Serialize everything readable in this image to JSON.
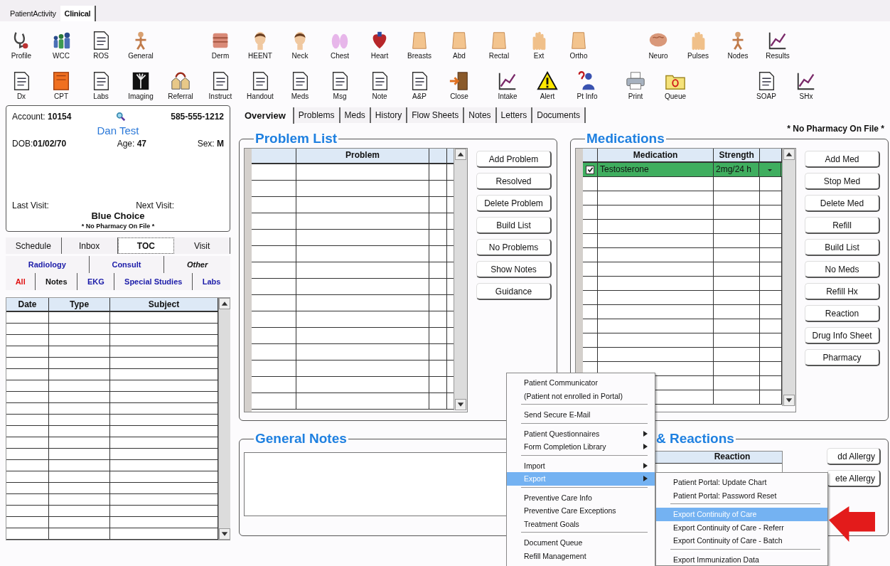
{
  "top_tabs": [
    {
      "label": "PatientActivity",
      "selected": false
    },
    {
      "label": "Clinical",
      "selected": true
    }
  ],
  "toolbar_rows": [
    [
      [
        {
          "label": "Profile",
          "kind": "stethoscope"
        },
        {
          "label": "WCC",
          "kind": "people"
        },
        {
          "label": "ROS",
          "kind": "document"
        },
        {
          "label": "General",
          "kind": "body"
        }
      ],
      [
        {
          "label": "Derm",
          "kind": "skin"
        },
        {
          "label": "HEENT",
          "kind": "head"
        },
        {
          "label": "Neck",
          "kind": "head"
        },
        {
          "label": "Chest",
          "kind": "lungs"
        },
        {
          "label": "Heart",
          "kind": "heart"
        },
        {
          "label": "Breasts",
          "kind": "torso"
        },
        {
          "label": "Abd",
          "kind": "torso"
        },
        {
          "label": "Rectal",
          "kind": "torso"
        },
        {
          "label": "Ext",
          "kind": "hand"
        },
        {
          "label": "Ortho",
          "kind": "torso"
        }
      ],
      [
        {
          "label": "Neuro",
          "kind": "brain"
        },
        {
          "label": "Pulses",
          "kind": "hand"
        },
        {
          "label": "Nodes",
          "kind": "body"
        },
        {
          "label": "Results",
          "kind": "chart"
        }
      ]
    ],
    [
      [
        {
          "label": "Dx",
          "kind": "document"
        },
        {
          "label": "CPT",
          "kind": "book"
        },
        {
          "label": "Labs",
          "kind": "document"
        },
        {
          "label": "Imaging",
          "kind": "xray"
        },
        {
          "label": "Referral",
          "kind": "houses"
        },
        {
          "label": "Instruct",
          "kind": "document"
        },
        {
          "label": "Handout",
          "kind": "document"
        },
        {
          "label": "Meds",
          "kind": "document"
        },
        {
          "label": "Msg",
          "kind": "document"
        },
        {
          "label": "Note",
          "kind": "document"
        },
        {
          "label": "A&P",
          "kind": "document"
        },
        {
          "label": "Close",
          "kind": "door"
        }
      ],
      [
        {
          "label": "Intake",
          "kind": "chart"
        },
        {
          "label": "Alert",
          "kind": "warning"
        },
        {
          "label": "Pt Info",
          "kind": "person"
        }
      ],
      [
        {
          "label": "Print",
          "kind": "printer"
        },
        {
          "label": "Queue",
          "kind": "folder"
        }
      ],
      [
        {
          "label": "SOAP",
          "kind": "document"
        },
        {
          "label": "SHx",
          "kind": "chart"
        }
      ]
    ]
  ],
  "patient": {
    "account": "Account: **10154**",
    "phone": "585-555-1212",
    "name": "Dan Test",
    "dob": "DOB:**01/02/70**",
    "age": "Age: **47**",
    "sex": "Sex: **M**",
    "last_visit": "Last Visit:",
    "next_visit": "Next Visit:",
    "insurance": "Blue Choice",
    "pharmacy": "* No Pharmacy On File *"
  },
  "left_tabs": [
    {
      "label": "Schedule",
      "selected": false
    },
    {
      "label": "Inbox",
      "selected": false
    },
    {
      "label": "TOC",
      "selected": true
    },
    {
      "label": "Visit",
      "selected": false
    }
  ],
  "category_tabs": [
    {
      "label": "Radiology",
      "color": "#1a1aa8",
      "italic": false
    },
    {
      "label": "Consult",
      "color": "#1a1aa8",
      "italic": false
    },
    {
      "label": "Other",
      "color": "#111111",
      "italic": true
    }
  ],
  "filter_tabs": [
    {
      "label": "All",
      "color": "#e01010"
    },
    {
      "label": "Notes",
      "color": "#111111"
    },
    {
      "label": "EKG",
      "color": "#1a1aa8"
    },
    {
      "label": "Special Studies",
      "color": "#1a1aa8"
    },
    {
      "label": "Labs",
      "color": "#1a1aa8"
    }
  ],
  "documents_table": {
    "columns": [
      "Date",
      "Type",
      "Subject"
    ]
  },
  "main_tabs": [
    {
      "label": "Overview",
      "selected": true
    },
    {
      "label": "Problems",
      "selected": false
    },
    {
      "label": "Meds",
      "selected": false
    },
    {
      "label": "History",
      "selected": false
    },
    {
      "label": "Flow Sheets",
      "selected": false
    },
    {
      "label": "Notes",
      "selected": false
    },
    {
      "label": "Letters",
      "selected": false
    },
    {
      "label": "Documents",
      "selected": false
    }
  ],
  "problem_list": {
    "title": "Problem List",
    "columns": [
      "Problem"
    ],
    "buttons": [
      "Add Problem",
      "Resolved",
      "Delete Problem",
      "Build List",
      "No Problems",
      "Show Notes",
      "Guidance"
    ]
  },
  "medications": {
    "title": "Medications",
    "pharmacy_note": "* No Pharmacy On File *",
    "columns": [
      "Medication",
      "Strength"
    ],
    "rows": [
      {
        "checked": true,
        "selected": true,
        "medication": "Testosterone",
        "strength": "2mg/24 h"
      }
    ],
    "buttons": [
      "Add Med",
      "Stop Med",
      "Delete Med",
      "Refill",
      "Build List",
      "No Meds",
      "Refill Hx",
      "Reaction",
      "Drug Info Sheet",
      "Pharmacy"
    ]
  },
  "general_notes": {
    "title": "General Notes"
  },
  "allergies": {
    "title": "& Reactions",
    "columns": [
      "Reaction"
    ],
    "buttons": [
      "dd Allergy",
      "ete Allergy"
    ]
  },
  "context_menu": {
    "groups": [
      [
        {
          "label": "Patient Communicator",
          "submenu": false,
          "selected": false
        },
        {
          "label": "(Patient not enrolled in Portal)",
          "submenu": false,
          "selected": false
        }
      ],
      [
        {
          "label": "Send Secure E-Mail",
          "submenu": false,
          "selected": false
        }
      ],
      [
        {
          "label": "Patient Questionnaires",
          "submenu": true,
          "selected": false
        },
        {
          "label": "Form Completion Library",
          "submenu": true,
          "selected": false
        }
      ],
      [
        {
          "label": "Import",
          "submenu": true,
          "selected": false
        },
        {
          "label": "Export",
          "submenu": true,
          "selected": true
        }
      ],
      [
        {
          "label": "Preventive Care Info",
          "submenu": false,
          "selected": false
        },
        {
          "label": "Preventive Care Exceptions",
          "submenu": false,
          "selected": false
        },
        {
          "label": "Treatment Goals",
          "submenu": false,
          "selected": false
        }
      ],
      [
        {
          "label": "Document Queue",
          "submenu": false,
          "selected": false
        },
        {
          "label": "Refill Management",
          "submenu": false,
          "selected": false
        }
      ]
    ]
  },
  "submenu": {
    "groups": [
      [
        {
          "label": "Patient Portal: Update Chart",
          "selected": false
        },
        {
          "label": "Patient Portal: Password Reset",
          "selected": false
        }
      ],
      [
        {
          "label": "Export Continuity of Care",
          "selected": true
        },
        {
          "label": "Export Continuity of Care - Referr",
          "selected": false
        },
        {
          "label": "Export Continuity of Care - Batch",
          "selected": false
        }
      ],
      [
        {
          "label": "Export Immunization Data",
          "selected": false
        }
      ]
    ]
  }
}
